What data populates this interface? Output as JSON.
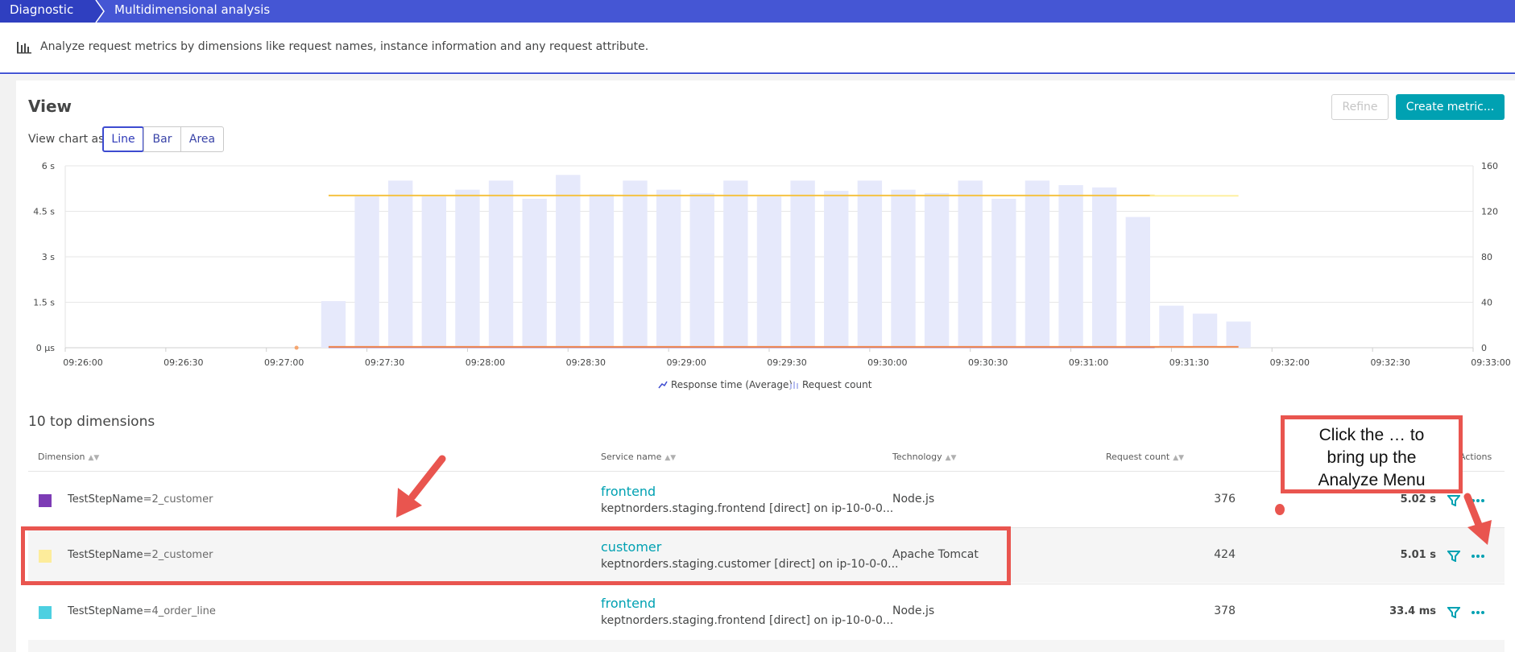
{
  "breadcrumb": [
    "Diagnostic tools",
    "Multidimensional analysis"
  ],
  "description": "Analyze request metrics by dimensions like request names, instance information and any request attribute.",
  "view": {
    "title": "View",
    "refine_label": "Refine",
    "create_metric_label": "Create metric...",
    "chart_as_label": "View chart as:",
    "chart_types": [
      "Line",
      "Bar",
      "Area"
    ],
    "selected_chart_type": "Line"
  },
  "colors": {
    "accent": "#4556d4",
    "teal": "#00a1b2",
    "bar": "#e6e9fb",
    "annotation_red": "#e9554f"
  },
  "chart_data": {
    "type": "bar",
    "x_ticks": [
      "09:26:00",
      "09:26:30",
      "09:27:00",
      "09:27:30",
      "09:28:00",
      "09:28:30",
      "09:29:00",
      "09:29:30",
      "09:30:00",
      "09:30:30",
      "09:31:00",
      "09:31:30",
      "09:32:00",
      "09:32:30",
      "09:33:00"
    ],
    "y_left_ticks": [
      "0 µs",
      "1.5 s",
      "3 s",
      "4.5 s",
      "6 s"
    ],
    "y_right_ticks": [
      "0",
      "40",
      "80",
      "120",
      "160"
    ],
    "y_left_range": [
      0,
      6
    ],
    "y_right_range": [
      0,
      160
    ],
    "grid": true,
    "series": [
      {
        "name": "Request count",
        "axis": "right",
        "x_start": "09:27:20",
        "x_step_seconds": 10,
        "values": [
          41,
          133,
          147,
          133,
          139,
          147,
          131,
          152,
          135,
          147,
          139,
          136,
          147,
          133,
          147,
          138,
          147,
          139,
          136,
          147,
          131,
          147,
          143,
          141,
          115,
          37,
          30,
          23
        ]
      },
      {
        "name": "Response time (Average)",
        "axis": "left",
        "lines": [
          {
            "color": "#f5c242",
            "start": "09:27:20",
            "end": "09:31:25",
            "value_s": 5.02
          },
          {
            "color": "#fdf0a0",
            "start": "09:31:25",
            "end": "09:31:50",
            "value_s": 5.01
          },
          {
            "color": "#7d3cb5",
            "start": "09:27:20",
            "end": "09:31:25",
            "value_s": 0.02
          },
          {
            "color": "#f08a50",
            "start": "09:27:20",
            "end": "09:31:50",
            "value_s": 0.03
          }
        ]
      }
    ],
    "legend": [
      "Response time (Average)",
      "Request count"
    ],
    "legend_position": "bottom"
  },
  "table": {
    "title": "10 top dimensions",
    "headers": {
      "dimension": "Dimension",
      "service": "Service name",
      "technology": "Technology",
      "count": "Request count",
      "actions": "Actions"
    },
    "rows": [
      {
        "color": "#7d3cb5",
        "dim_key": "TestStepName",
        "dim_val": "=2_customer",
        "service": "frontend",
        "service_detail": "keptnorders.staging.frontend [direct] on ip-10-0-0...",
        "technology": "Node.js",
        "count": "376",
        "response_time": "5.02 s"
      },
      {
        "color": "#fdec9b",
        "dim_key": "TestStepName",
        "dim_val": "=2_customer",
        "service": "customer",
        "service_detail": "keptnorders.staging.customer [direct] on ip-10-0-0...",
        "technology": "Apache Tomcat",
        "count": "424",
        "response_time": "5.01 s"
      },
      {
        "color": "#4dd0e1",
        "dim_key": "TestStepName",
        "dim_val": "=4_order_line",
        "service": "frontend",
        "service_detail": "keptnorders.staging.frontend [direct] on ip-10-0-0...",
        "technology": "Node.js",
        "count": "378",
        "response_time": "33.4 ms"
      }
    ]
  },
  "annotation": {
    "lines": [
      "Click the … to",
      "bring up the",
      "Analyze Menu"
    ]
  },
  "icons": [
    "bar-chart-icon",
    "sort-icon",
    "filter-icon",
    "more-icon",
    "arrow-icon"
  ]
}
